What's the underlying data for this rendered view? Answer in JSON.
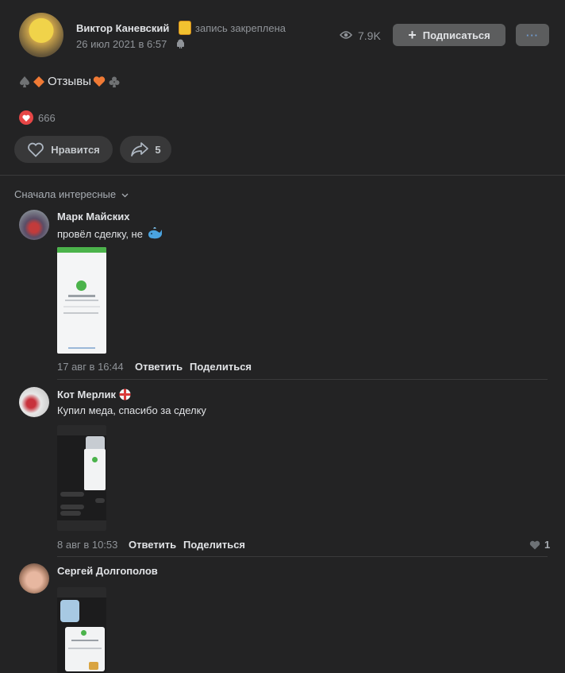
{
  "post": {
    "author": "Виктор Каневский",
    "pinned": "запись закреплена",
    "date": "26 июл 2021 в 6:57",
    "views": "7.9K",
    "subscribe_label": "Подписаться",
    "more_label": "···",
    "text": "Отзывы",
    "likes_count": "666",
    "like_label": "Нравится",
    "share_count": "5"
  },
  "comments": {
    "sort_label": "Сначала интересные",
    "items": [
      {
        "author": "Марк Майских",
        "text": "провёл сделку, не",
        "date": "17 авг в 16:44",
        "reply": "Ответить",
        "share": "Поделиться"
      },
      {
        "author": "Кот Мерлик",
        "text": "Купил меда, спасибо за сделку",
        "date": "8 авг в 10:53",
        "reply": "Ответить",
        "share": "Поделиться",
        "likes": "1"
      },
      {
        "author": "Сергей Долгополов"
      }
    ]
  },
  "colors": {
    "background": "#232324",
    "button": "#454647",
    "like_red": "#e64646",
    "accent_green": "#4bb34b"
  }
}
